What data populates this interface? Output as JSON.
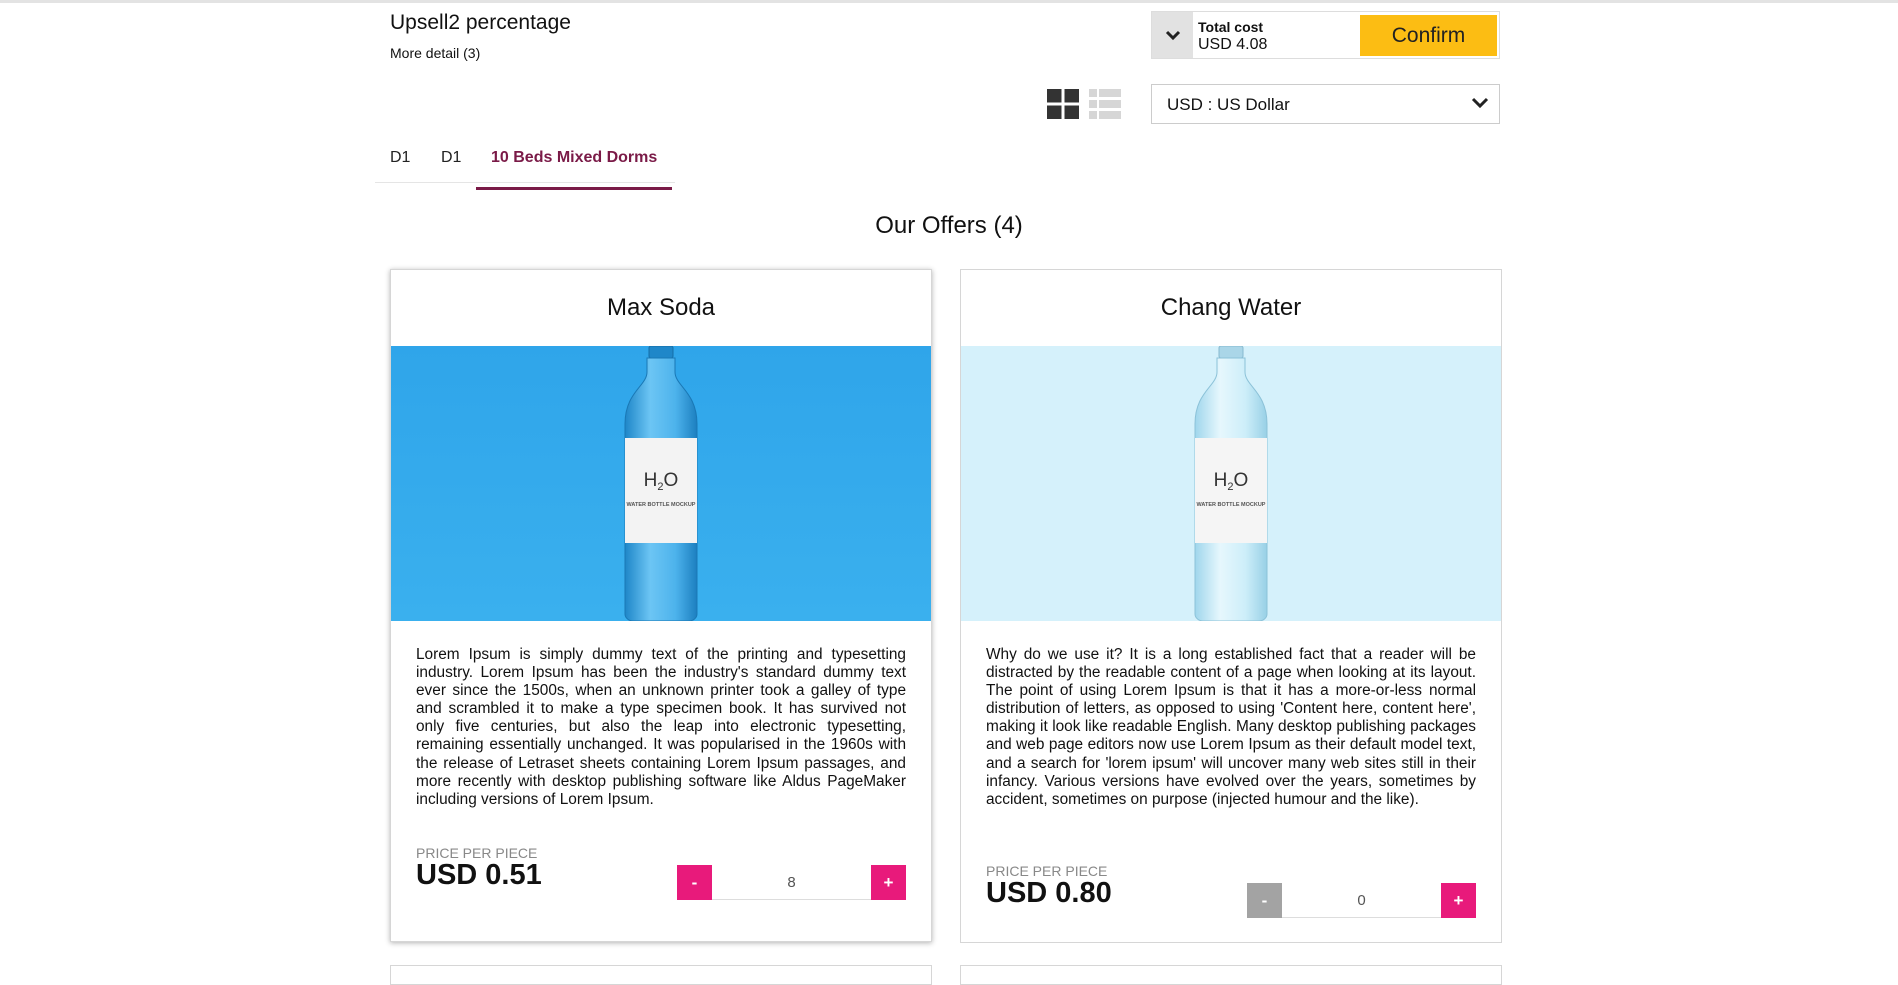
{
  "header": {
    "title": "Upsell2 percentage",
    "more_detail": "More detail (3)"
  },
  "cost": {
    "label": "Total cost",
    "value": "USD 4.08",
    "confirm_label": "Confirm",
    "toggle_icon": "chevron-down-icon"
  },
  "view_toggle": {
    "grid_icon": "grid-view-icon",
    "list_icon": "list-view-icon",
    "active": "grid"
  },
  "currency": {
    "selected": "USD : US Dollar"
  },
  "tabs": [
    {
      "label": "D1",
      "active": false
    },
    {
      "label": "D1",
      "active": false
    },
    {
      "label": "10 Beds Mixed Dorms",
      "active": true
    }
  ],
  "offers": {
    "heading": "Our Offers (4)",
    "items": [
      {
        "name": "Max Soda",
        "bottle_mark": "H",
        "bottle_sub": "2",
        "bottle_mark_end": "O",
        "bottle_caption": "WATER BOTTLE MOCKUP",
        "description": "Lorem Ipsum is simply dummy text of the printing and typesetting industry. Lorem Ipsum has been the industry's standard dummy text ever since the 1500s, when an unknown printer took a galley of type and scrambled it to make a type specimen book. It has survived not only five centuries, but also the leap into electronic typesetting, remaining essentially unchanged. It was popularised in the 1960s with the release of Letraset sheets containing Lorem Ipsum passages, and more recently with desktop publishing software like Aldus PageMaker including versions of Lorem Ipsum.",
        "price_label": "PRICE PER PIECE",
        "price": "USD 0.51",
        "minus_label": "-",
        "plus_label": "+",
        "quantity": "8",
        "minus_color": "#e81a7b",
        "image_bg": "#2fa5ea"
      },
      {
        "name": "Chang Water",
        "bottle_mark": "H",
        "bottle_sub": "2",
        "bottle_mark_end": "O",
        "bottle_caption": "WATER BOTTLE MOCKUP",
        "description": "Why do we use it? It is a long established fact that a reader will be distracted by the readable content of a page when looking at its layout. The point of using Lorem Ipsum is that it has a more-or-less normal distribution of letters, as opposed to using 'Content here, content here', making it look like readable English. Many desktop publishing packages and web page editors now use Lorem Ipsum as their default model text, and a search for 'lorem ipsum' will uncover many web sites still in their infancy. Various versions have evolved over the years, sometimes by accident, sometimes on purpose (injected humour and the like).",
        "price_label": "PRICE PER PIECE",
        "price": "USD 0.80",
        "minus_label": "-",
        "plus_label": "+",
        "quantity": "0",
        "minus_color": "#a3a3a3",
        "image_bg": "#d5f1fb"
      }
    ]
  },
  "colors": {
    "accent": "#7a1a47",
    "confirm": "#fcbd13",
    "stepper_plus": "#e81a7b"
  }
}
